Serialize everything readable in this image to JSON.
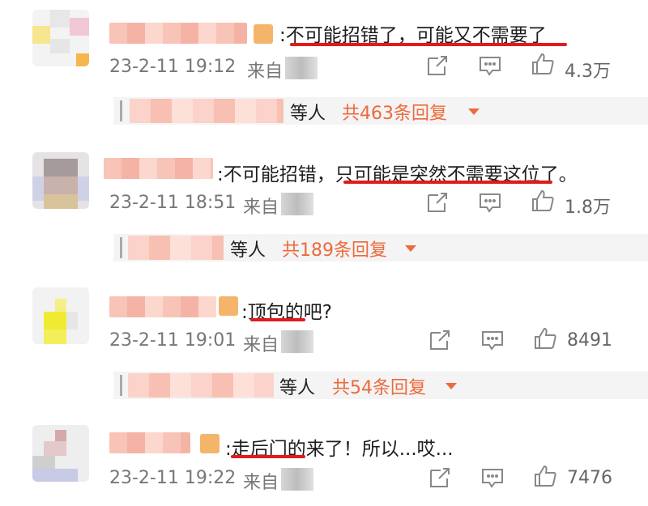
{
  "comments": [
    {
      "text": ":不可能招错了，可能又不需要了",
      "time": "23-2-11 19:12",
      "from": "来自",
      "likes": "4.3万",
      "reply_others": "等人",
      "reply_count": "共463条回复"
    },
    {
      "text": ":不可能招错，只可能是突然不需要这位了。",
      "time": "23-2-11 18:51",
      "from": "来自",
      "likes": "1.8万",
      "reply_others": "等人",
      "reply_count": "共189条回复"
    },
    {
      "text": ":顶包的吧?",
      "time": "23-2-11 19:01",
      "from": "来自",
      "likes": "8491",
      "reply_others": "等人",
      "reply_count": "共54条回复"
    },
    {
      "text": ":走后门的来了！所以...哎...",
      "time": "23-2-11 19:22",
      "from": "来自",
      "likes": "7476"
    }
  ],
  "colors": {
    "accent": "#ec6a3c",
    "underline": "#e11b1b",
    "meta": "#777777"
  },
  "icons": [
    "forward-icon",
    "comment-icon",
    "like-icon",
    "caret-down-icon"
  ]
}
